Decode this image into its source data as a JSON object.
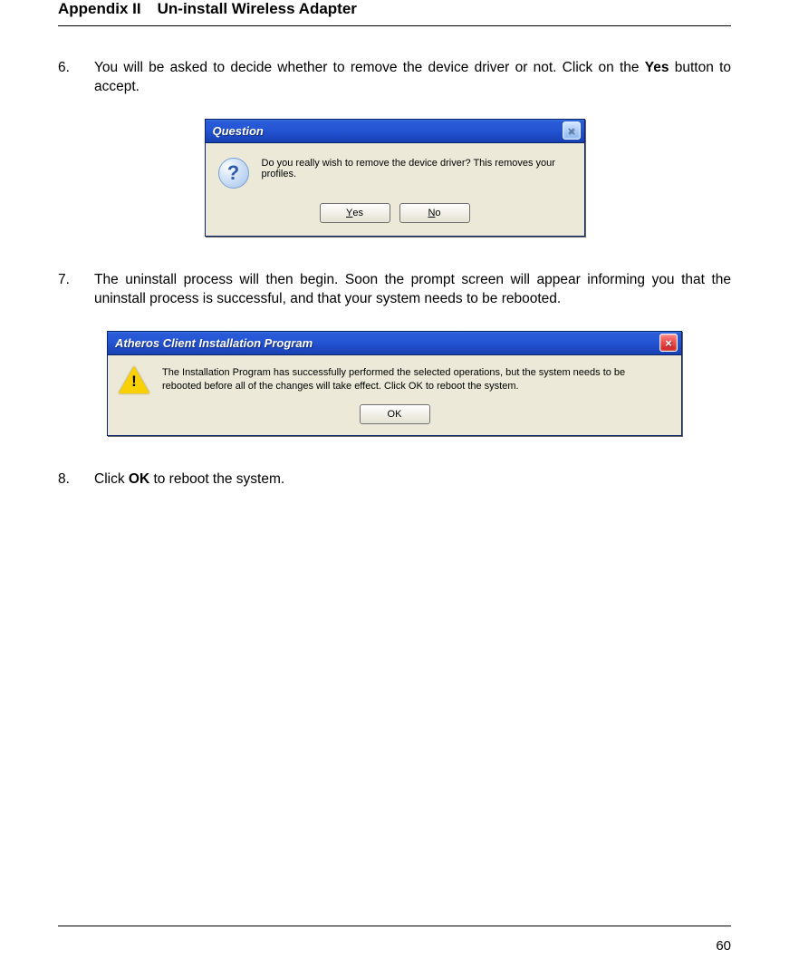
{
  "header": {
    "appendix": "Appendix II",
    "title": "Un-install Wireless Adapter"
  },
  "steps": {
    "s6": {
      "num": "6.",
      "text_before": "You will be asked to decide whether to remove the device driver or not. Click on the ",
      "bold": "Yes",
      "text_after": " button to accept."
    },
    "s7": {
      "num": "7.",
      "text": "The uninstall process will then begin. Soon the prompt screen will appear informing you that the uninstall process is successful, and that your system needs to be rebooted."
    },
    "s8": {
      "num": "8.",
      "text_before": "Click ",
      "bold": "OK",
      "text_after": " to reboot the system."
    }
  },
  "dialog1": {
    "title": "Question",
    "message": "Do you really wish to remove the device driver? This removes your profiles.",
    "yes_u": "Y",
    "yes_rest": "es",
    "no_u": "N",
    "no_rest": "o",
    "close_glyph": "×"
  },
  "dialog2": {
    "title": "Atheros Client Installation Program",
    "message": "The Installation Program has successfully performed the selected operations, but the system needs to be rebooted before all of the changes will take effect. Click OK to reboot the system.",
    "ok_label": "OK",
    "close_glyph": "×"
  },
  "page_number": "60"
}
